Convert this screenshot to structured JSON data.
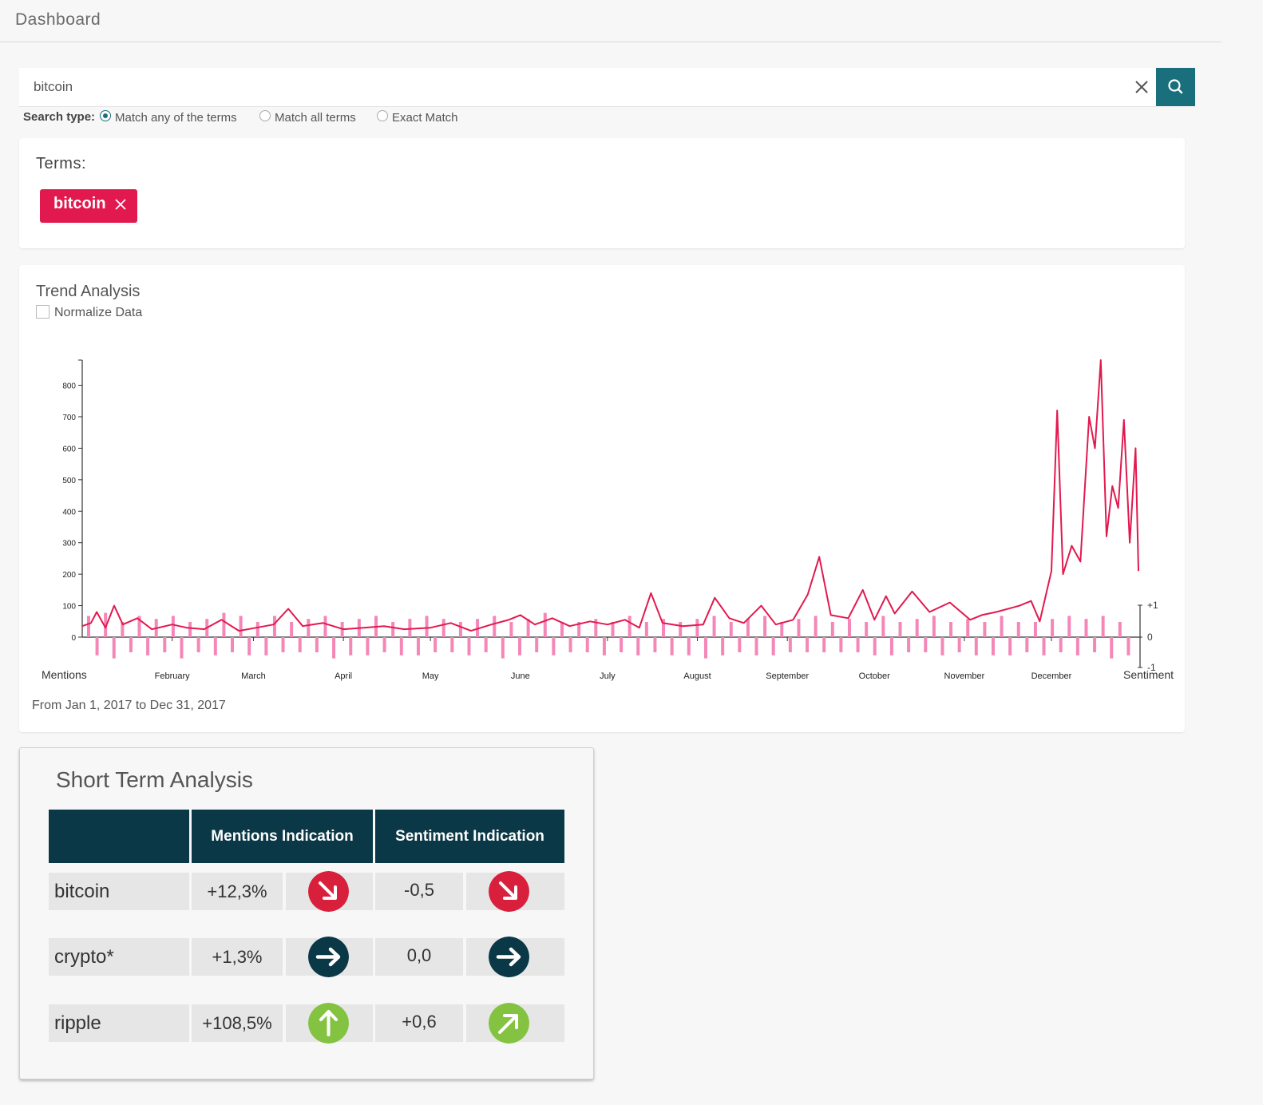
{
  "header": {
    "title": "Dashboard"
  },
  "search": {
    "value": "bitcoin",
    "clear_icon": "close-icon",
    "search_icon": "search-icon",
    "accent": "#19707c"
  },
  "search_type": {
    "label": "Search type:",
    "options": [
      {
        "label": "Match any of the terms",
        "selected": true
      },
      {
        "label": "Match all terms",
        "selected": false
      },
      {
        "label": "Exact Match",
        "selected": false
      }
    ]
  },
  "terms": {
    "heading": "Terms:",
    "chips": [
      {
        "label": "bitcoin",
        "color": "#e2194e"
      }
    ]
  },
  "trend": {
    "heading": "Trend Analysis",
    "normalize_label": "Normalize Data",
    "normalize_checked": false,
    "range_text": "From Jan 1, 2017 to Dec 31, 2017"
  },
  "chart_data": {
    "type": "line",
    "title": "",
    "xlabel": "Mentions",
    "ylabel_right": "Sentiment",
    "ylim": [
      0,
      880
    ],
    "yticks": [
      0,
      100,
      200,
      300,
      400,
      500,
      600,
      700,
      800
    ],
    "sentiment_ticks": [
      "+1",
      "0",
      "-1"
    ],
    "month_ticks": [
      "February",
      "March",
      "April",
      "May",
      "June",
      "July",
      "August",
      "September",
      "October",
      "November",
      "December"
    ],
    "x_start": "2017-01-01",
    "x_end": "2017-12-31",
    "series": [
      {
        "color": "#e2194e",
        "points": [
          [
            "2017-01-01",
            35
          ],
          [
            "2017-01-04",
            45
          ],
          [
            "2017-01-06",
            80
          ],
          [
            "2017-01-09",
            30
          ],
          [
            "2017-01-12",
            100
          ],
          [
            "2017-01-15",
            40
          ],
          [
            "2017-01-20",
            60
          ],
          [
            "2017-01-25",
            25
          ],
          [
            "2017-02-01",
            40
          ],
          [
            "2017-02-06",
            30
          ],
          [
            "2017-02-12",
            25
          ],
          [
            "2017-02-18",
            55
          ],
          [
            "2017-02-24",
            20
          ],
          [
            "2017-03-02",
            30
          ],
          [
            "2017-03-08",
            40
          ],
          [
            "2017-03-13",
            90
          ],
          [
            "2017-03-18",
            35
          ],
          [
            "2017-03-25",
            45
          ],
          [
            "2017-04-01",
            25
          ],
          [
            "2017-04-08",
            30
          ],
          [
            "2017-04-15",
            35
          ],
          [
            "2017-04-22",
            25
          ],
          [
            "2017-05-01",
            30
          ],
          [
            "2017-05-08",
            45
          ],
          [
            "2017-05-15",
            20
          ],
          [
            "2017-05-22",
            40
          ],
          [
            "2017-05-28",
            55
          ],
          [
            "2017-06-01",
            70
          ],
          [
            "2017-06-06",
            40
          ],
          [
            "2017-06-12",
            60
          ],
          [
            "2017-06-18",
            35
          ],
          [
            "2017-06-25",
            50
          ],
          [
            "2017-07-01",
            40
          ],
          [
            "2017-07-07",
            55
          ],
          [
            "2017-07-12",
            30
          ],
          [
            "2017-07-16",
            140
          ],
          [
            "2017-07-20",
            45
          ],
          [
            "2017-07-27",
            35
          ],
          [
            "2017-08-03",
            40
          ],
          [
            "2017-08-07",
            125
          ],
          [
            "2017-08-12",
            60
          ],
          [
            "2017-08-17",
            45
          ],
          [
            "2017-08-23",
            100
          ],
          [
            "2017-08-28",
            40
          ],
          [
            "2017-09-03",
            55
          ],
          [
            "2017-09-08",
            135
          ],
          [
            "2017-09-12",
            255
          ],
          [
            "2017-09-16",
            70
          ],
          [
            "2017-09-22",
            60
          ],
          [
            "2017-09-27",
            150
          ],
          [
            "2017-10-01",
            55
          ],
          [
            "2017-10-05",
            130
          ],
          [
            "2017-10-08",
            75
          ],
          [
            "2017-10-14",
            145
          ],
          [
            "2017-10-20",
            80
          ],
          [
            "2017-10-27",
            110
          ],
          [
            "2017-11-03",
            55
          ],
          [
            "2017-11-07",
            70
          ],
          [
            "2017-11-12",
            80
          ],
          [
            "2017-11-20",
            100
          ],
          [
            "2017-11-24",
            115
          ],
          [
            "2017-11-27",
            50
          ],
          [
            "2017-12-01",
            210
          ],
          [
            "2017-12-03",
            720
          ],
          [
            "2017-12-05",
            200
          ],
          [
            "2017-12-08",
            290
          ],
          [
            "2017-12-11",
            240
          ],
          [
            "2017-12-14",
            700
          ],
          [
            "2017-12-16",
            600
          ],
          [
            "2017-12-18",
            880
          ],
          [
            "2017-12-20",
            320
          ],
          [
            "2017-12-22",
            480
          ],
          [
            "2017-12-24",
            410
          ],
          [
            "2017-12-26",
            690
          ],
          [
            "2017-12-28",
            300
          ],
          [
            "2017-12-30",
            600
          ],
          [
            "2017-12-31",
            210
          ]
        ]
      }
    ],
    "sentiment": {
      "color": "#f487b8",
      "values": [
        0.7,
        -0.6,
        0.8,
        -0.7,
        0.5,
        -0.5,
        0.7,
        -0.6,
        0.6,
        -0.5,
        0.7,
        -0.7,
        0.5,
        -0.5,
        0.6,
        -0.6,
        0.8,
        -0.5,
        0.7,
        -0.6,
        0.5,
        -0.6,
        0.7,
        -0.5,
        0.5,
        -0.5,
        0.6,
        -0.5,
        0.7,
        -0.7,
        0.5,
        -0.6,
        0.6,
        -0.6,
        0.7,
        -0.5,
        0.5,
        -0.6,
        0.6,
        -0.6,
        0.7,
        -0.5,
        0.6,
        -0.5,
        0.5,
        -0.6,
        0.6,
        -0.5,
        0.7,
        -0.7,
        0.5,
        -0.6,
        0.6,
        -0.5,
        0.8,
        -0.6,
        0.5,
        -0.5,
        0.5,
        -0.5,
        0.6,
        -0.6,
        0.5,
        -0.5,
        0.7,
        -0.6,
        0.5,
        -0.5,
        0.6,
        -0.6,
        0.5,
        -0.6,
        0.6,
        -0.7,
        0.7,
        -0.6,
        0.5,
        -0.5,
        0.6,
        -0.6,
        0.7,
        -0.6,
        0.5,
        -0.5,
        0.6,
        -0.5,
        0.7,
        -0.5,
        0.5,
        -0.5,
        0.6,
        -0.5,
        0.5,
        -0.6,
        0.7,
        -0.6,
        0.5,
        -0.5,
        0.6,
        -0.5,
        0.7,
        -0.6,
        0.5,
        -0.5,
        0.6,
        -0.6,
        0.5,
        -0.6,
        0.7,
        -0.6,
        0.5,
        -0.5,
        0.5,
        -0.6,
        0.6,
        -0.5,
        0.7,
        -0.6,
        0.6,
        -0.5,
        0.7,
        -0.7,
        0.5,
        -0.6
      ]
    }
  },
  "short_term": {
    "heading": "Short Term Analysis",
    "columns": [
      "",
      "Mentions Indication",
      "Sentiment Indication"
    ],
    "rows": [
      {
        "term": "bitcoin",
        "mentions": "+12,3%",
        "mentions_icon": "arrow-down-right-icon",
        "mentions_color": "#d8203c",
        "sentiment": "-0,5",
        "sentiment_icon": "arrow-down-right-icon",
        "sentiment_color": "#d8203c"
      },
      {
        "term": "crypto*",
        "mentions": "+1,3%",
        "mentions_icon": "arrow-right-icon",
        "mentions_color": "#0b3846",
        "sentiment": "0,0",
        "sentiment_icon": "arrow-right-icon",
        "sentiment_color": "#0b3846"
      },
      {
        "term": "ripple",
        "mentions": "+108,5%",
        "mentions_icon": "arrow-up-icon",
        "mentions_color": "#84c341",
        "sentiment": "+0,6",
        "sentiment_icon": "arrow-up-right-icon",
        "sentiment_color": "#84c341"
      }
    ]
  }
}
